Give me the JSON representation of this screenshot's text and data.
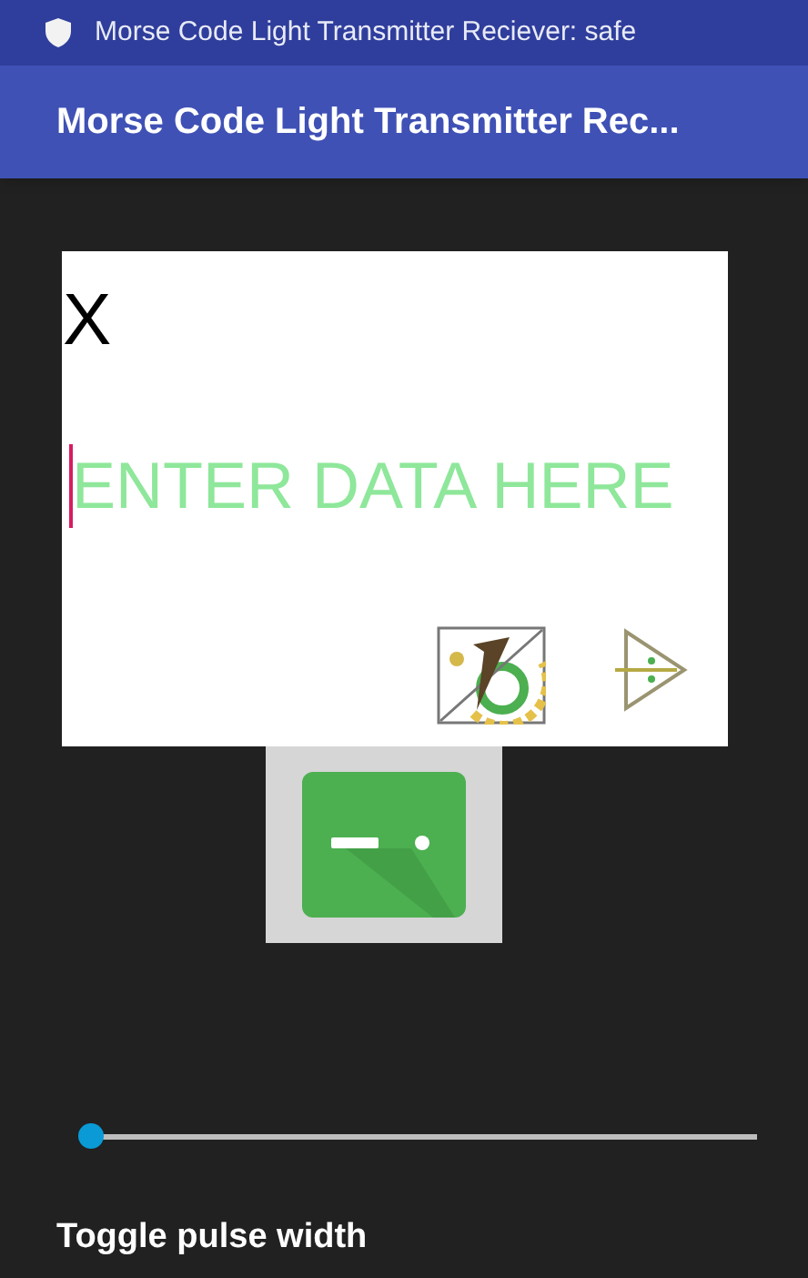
{
  "status_bar": {
    "text": "Morse Code Light Transmitter Reciever: safe"
  },
  "app_bar": {
    "title": "Morse Code Light Transmitter Rec..."
  },
  "input_card": {
    "close_label": "X",
    "field": {
      "placeholder": "ENTER DATA HERE",
      "focused": true
    }
  },
  "slider": {
    "level": 0
  },
  "slider_label": "Toggle pulse width"
}
